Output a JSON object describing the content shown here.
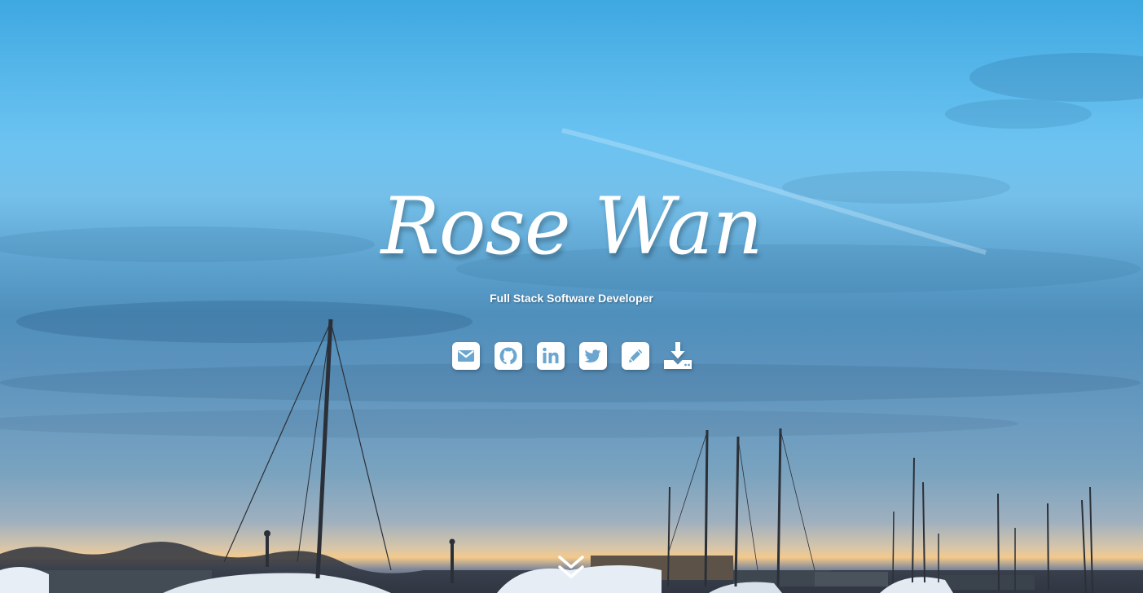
{
  "hero": {
    "name": "Rose Wan",
    "tagline": "Full Stack Software Developer"
  },
  "social_links": [
    {
      "icon": "envelope-icon",
      "label": "Email"
    },
    {
      "icon": "github-icon",
      "label": "GitHub"
    },
    {
      "icon": "linkedin-icon",
      "label": "LinkedIn"
    },
    {
      "icon": "twitter-icon",
      "label": "Twitter"
    },
    {
      "icon": "pencil-icon",
      "label": "Blog"
    },
    {
      "icon": "download-icon",
      "label": "Download Resume"
    }
  ],
  "scroll": {
    "icon": "double-chevron-down-icon"
  },
  "colors": {
    "text": "#ffffff",
    "sky_top": "#3ea8e0",
    "sunset": "#f4c98a"
  }
}
